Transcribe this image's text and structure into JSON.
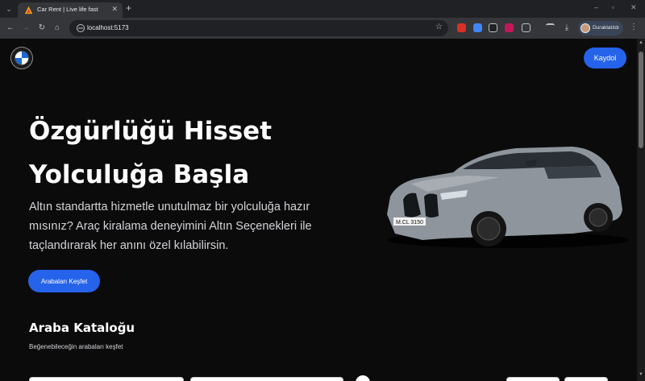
{
  "browser": {
    "tab_title": "Car Rent | Live life fast",
    "url": "localhost:5173",
    "profile_label": "Duraklatıldı",
    "controls": {
      "minimize": "–",
      "maximize": "▫",
      "close": "✕"
    }
  },
  "header": {
    "logo_icon": "bmw-logo-icon",
    "signup_label": "Kaydol"
  },
  "hero": {
    "title_line1": "Özgürlüğü Hisset",
    "title_line2": "Yolculuğa Başla",
    "subtitle": "Altın standartta hizmetle unutulmaz bir yolculuğa hazır mısınız? Araç kiralama deneyimini Altın Seçenekleri ile taçlandırarak her anını özel kılabilirsin.",
    "cta_label": "Arabaları Keşfet",
    "car_plate": "M.CL 3150"
  },
  "catalog": {
    "title": "Araba Kataloğu",
    "subtitle": "Beğenebileceğin arabaları keşfet"
  },
  "colors": {
    "accent": "#2563eb",
    "page_bg": "#0b0b0c",
    "car_body": "#8e959c"
  }
}
